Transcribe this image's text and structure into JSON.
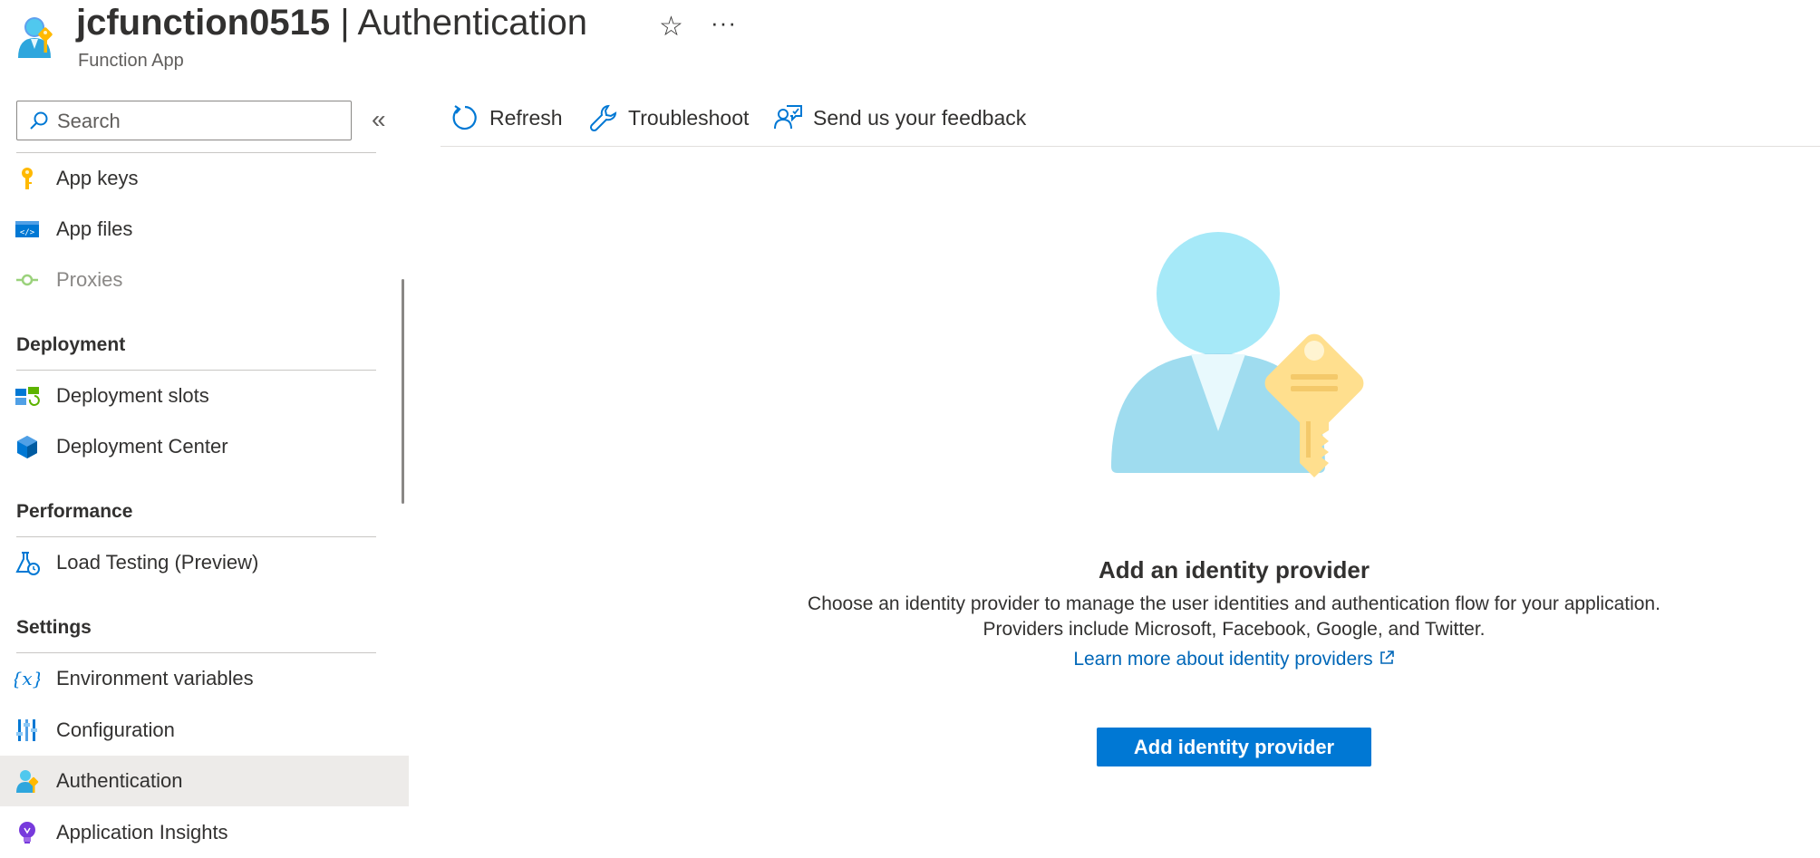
{
  "header": {
    "resource_name": "jcfunction0515",
    "separator": " | ",
    "page_name": "Authentication",
    "subtitle": "Function App",
    "favorite_icon": "star-icon",
    "more_icon": "ellipsis-icon",
    "star_glyph": "☆",
    "more_glyph": "···"
  },
  "search": {
    "placeholder": "Search",
    "collapse_glyph": "«"
  },
  "sidebar": {
    "items_top": [
      {
        "label": "App keys",
        "icon": "key-icon"
      },
      {
        "label": "App files",
        "icon": "code-file-icon"
      },
      {
        "label": "Proxies",
        "icon": "proxy-icon",
        "disabled": true
      }
    ],
    "sections": [
      {
        "title": "Deployment",
        "items": [
          {
            "label": "Deployment slots",
            "icon": "deployment-slots-icon"
          },
          {
            "label": "Deployment Center",
            "icon": "cube-icon"
          }
        ]
      },
      {
        "title": "Performance",
        "items": [
          {
            "label": "Load Testing (Preview)",
            "icon": "flask-icon"
          }
        ]
      },
      {
        "title": "Settings",
        "items": [
          {
            "label": "Environment variables",
            "icon": "variable-icon"
          },
          {
            "label": "Configuration",
            "icon": "sliders-icon"
          },
          {
            "label": "Authentication",
            "icon": "user-key-icon",
            "active": true
          },
          {
            "label": "Application Insights",
            "icon": "lightbulb-icon"
          }
        ]
      }
    ]
  },
  "toolbar": {
    "refresh": "Refresh",
    "troubleshoot": "Troubleshoot",
    "feedback": "Send us your feedback"
  },
  "empty_state": {
    "title": "Add an identity provider",
    "description_line1": "Choose an identity provider to manage the user identities and authentication flow for your application.",
    "description_line2": "Providers include Microsoft, Facebook, Google, and Twitter.",
    "learn_more": "Learn more about identity providers",
    "button": "Add identity provider"
  },
  "colors": {
    "accent": "#0078d4",
    "link": "#0067b8",
    "active_nav_bg": "#edebe9"
  }
}
